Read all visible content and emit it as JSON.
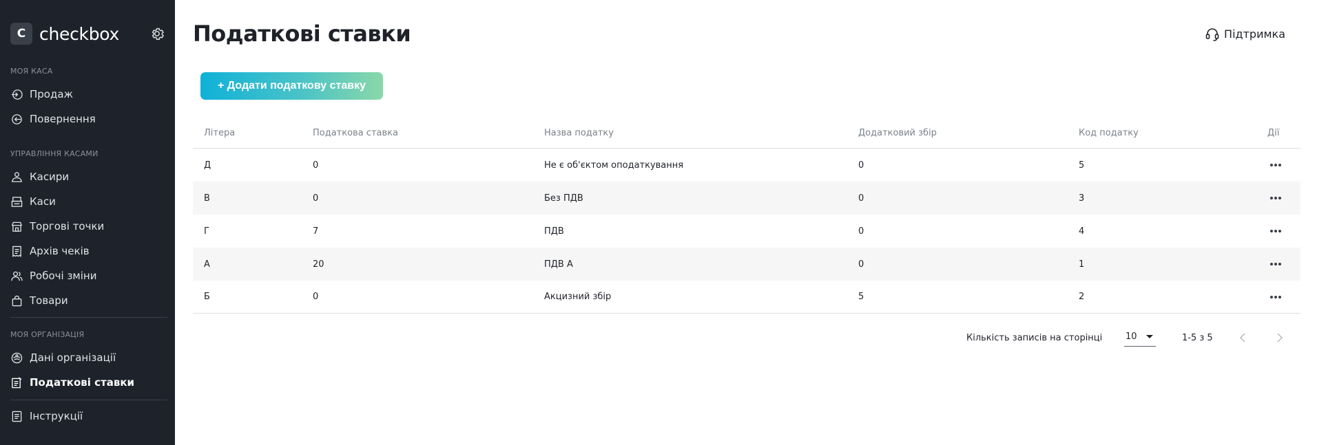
{
  "app": {
    "logo_letter": "C",
    "logo_text": "checkbox"
  },
  "sidebar": {
    "sections": [
      {
        "label": "МОЯ КАСА"
      },
      {
        "label": "УПРАВЛІННЯ КАСАМИ"
      },
      {
        "label": "МОЯ ОРГАНІЗАЦІЯ"
      }
    ],
    "items": [
      {
        "label": "Продаж",
        "icon": "sale-icon"
      },
      {
        "label": "Повернення",
        "icon": "return-icon"
      },
      {
        "label": "Касири",
        "icon": "cashiers-icon"
      },
      {
        "label": "Каси",
        "icon": "cash-register-icon"
      },
      {
        "label": "Торгові точки",
        "icon": "store-icon"
      },
      {
        "label": "Архів чеків",
        "icon": "receipt-archive-icon"
      },
      {
        "label": "Робочі зміни",
        "icon": "shifts-icon"
      },
      {
        "label": "Товари",
        "icon": "bag-icon"
      },
      {
        "label": "Дані організації",
        "icon": "organization-icon"
      },
      {
        "label": "Податкові ставки",
        "icon": "tax-rates-icon",
        "active": true
      },
      {
        "label": "Інструкції",
        "icon": "instructions-icon"
      }
    ]
  },
  "header": {
    "title": "Податкові ставки",
    "support_label": "Підтримка"
  },
  "toolbar": {
    "add_label": "+ Додати податкову ставку"
  },
  "table": {
    "columns": [
      "Літера",
      "Податкова ставка",
      "Назва податку",
      "Додатковий збір",
      "Код податку",
      "Дії"
    ],
    "rows": [
      [
        "Д",
        "0",
        "Не є об'єктом оподаткування",
        "0",
        "5"
      ],
      [
        "В",
        "0",
        "Без ПДВ",
        "0",
        "3"
      ],
      [
        "Г",
        "7",
        "ПДВ",
        "0",
        "4"
      ],
      [
        "А",
        "20",
        "ПДВ А",
        "0",
        "1"
      ],
      [
        "Б",
        "0",
        "Акцизний збір",
        "5",
        "2"
      ]
    ]
  },
  "pagination": {
    "per_page_label": "Кількість записів на сторінці",
    "per_page_value": "10",
    "range_text": "1-5 з 5"
  },
  "colors": {
    "sidebar_bg": "#1e232b",
    "accent_gradient_start": "#0fb1d8",
    "accent_gradient_end": "#8ad8a9",
    "row_alt_bg": "#f6f6f6"
  }
}
